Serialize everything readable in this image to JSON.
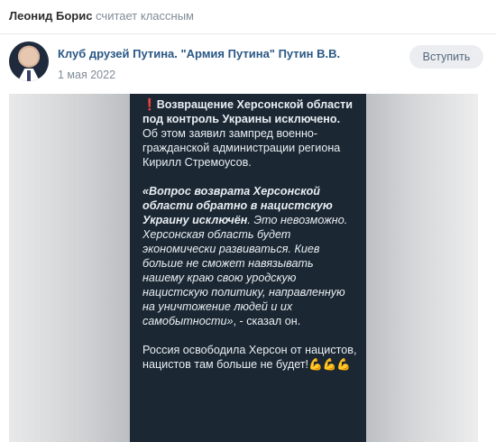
{
  "reaction": {
    "user": "Леонид Борис",
    "action": "считает классным"
  },
  "post": {
    "group_name": "Клуб друзей Путина. \"Армия Путина\" Путин В.В.",
    "date": "1 мая 2022",
    "join_label": "Вступить"
  },
  "screenshot_text": {
    "lead_bold": "Возвращение Херсонской области под контроль Украины исключено.",
    "lead_rest": " Об этом заявил зампред военно-гражданской администрации региона Кирилл Стремоусов.",
    "quote_bold": "«Вопрос возврата Херсонской области обратно в нацистскую Украину исключён",
    "quote_mid": ". Это невозможно. Херсонская область будет экономически развиваться. Киев больше не сможет навязывать нашему краю свою уродскую нацистскую политику, направленную на уничтожение людей и их самобытности»",
    "quote_end": ", - сказал он.",
    "closing": "Россия освободила Херсон от нацистов, нацистов там больше не будет!",
    "emoji": "💪💪💪"
  },
  "colors": {
    "link": "#2a5885",
    "muted": "#818c99",
    "screen_bg": "#1b2733",
    "alert": "#e53935"
  },
  "icons": {
    "alert": "exclamation-icon",
    "avatar": "avatar"
  }
}
